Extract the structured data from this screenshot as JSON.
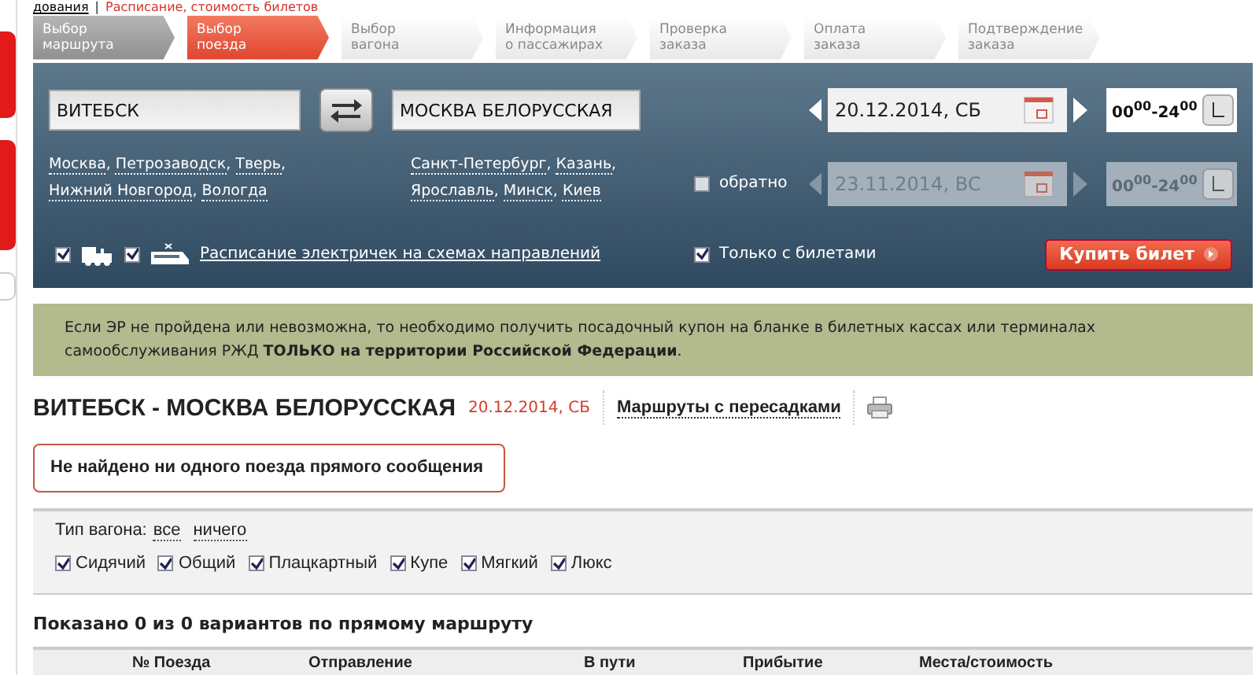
{
  "top_links": [
    {
      "text": "дования",
      "kind": "plain"
    },
    {
      "text": "|",
      "kind": "separator"
    },
    {
      "text": "Расписание, стоимость билетов",
      "kind": "link"
    }
  ],
  "steps": [
    {
      "lines": [
        "Выбор",
        "маршрута"
      ],
      "kind": "done"
    },
    {
      "lines": [
        "Выбор",
        "поезда"
      ],
      "kind": "current"
    },
    {
      "lines": [
        "Выбор",
        "вагона"
      ],
      "kind": "todo"
    },
    {
      "lines": [
        "Информация",
        "о пассажирах"
      ],
      "kind": "todo"
    },
    {
      "lines": [
        "Проверка",
        "заказа"
      ],
      "kind": "todo"
    },
    {
      "lines": [
        "Оплата",
        "заказа"
      ],
      "kind": "todo"
    },
    {
      "lines": [
        "Подтверждение",
        "заказа"
      ],
      "kind": "todo"
    }
  ],
  "search": {
    "from": "ВИТЕБСК",
    "to": "МОСКВА БЕЛОРУССКАЯ",
    "from_suggestions": [
      {
        "city": "Москва",
        "sep": ","
      },
      {
        "city": "Петрозаводск",
        "sep": ","
      },
      {
        "city": "Тверь",
        "sep": ","
      },
      {
        "city": "Нижний Новгород",
        "sep": ","
      },
      {
        "city": "Вологда"
      }
    ],
    "to_suggestions": [
      {
        "city": "Санкт-Петербург",
        "sep": ","
      },
      {
        "city": "Казань",
        "sep": ","
      },
      {
        "city": "Ярославль",
        "sep": ","
      },
      {
        "city": "Минск",
        "sep": ","
      },
      {
        "city": "Киев"
      }
    ],
    "date": "20.12.2014, СБ",
    "time": "00$^{00}$-24$^{00}$",
    "return": {
      "label": "обратно",
      "checked": false,
      "date": "23.11.2014, ВС",
      "time": "00$^{00}$-24$^{00}$"
    },
    "train_checked": true,
    "suburban_checked": true,
    "schedule_link": "Расписание электричек на схемах направлений",
    "only_tickets": {
      "label": "Только с билетами",
      "checked": true
    },
    "buy_button": "Купить билет"
  },
  "notice": "Если ЭР не пройдена или невозможна, то необходимо получить посадочный купон на бланке в билетных кассах или терминалах самообслуживания РЖД **ТОЛЬКО на территории Российской Федерации**.",
  "result": {
    "title": "ВИТЕБСК - МОСКВА БЕЛОРУССКАЯ",
    "date": "20.12.2014, СБ",
    "transfers_link": "Маршруты с пересадками",
    "error": "Не найдено ни одного поезда прямого сообщения"
  },
  "filter": {
    "label": "Тип вагона:",
    "all": "все",
    "none": "ничего",
    "types": [
      {
        "label": "Сидячий",
        "checked": true
      },
      {
        "label": "Общий",
        "checked": true
      },
      {
        "label": "Плацкартный",
        "checked": true
      },
      {
        "label": "Купе",
        "checked": true
      },
      {
        "label": "Мягкий",
        "checked": true
      },
      {
        "label": "Люкс",
        "checked": true
      }
    ]
  },
  "summary": "Показано 0 из 0 вариантов по прямому маршруту",
  "columns": [
    "№ Поезда",
    "Отправление",
    "В пути",
    "Прибытие",
    "Места/стоимость"
  ]
}
